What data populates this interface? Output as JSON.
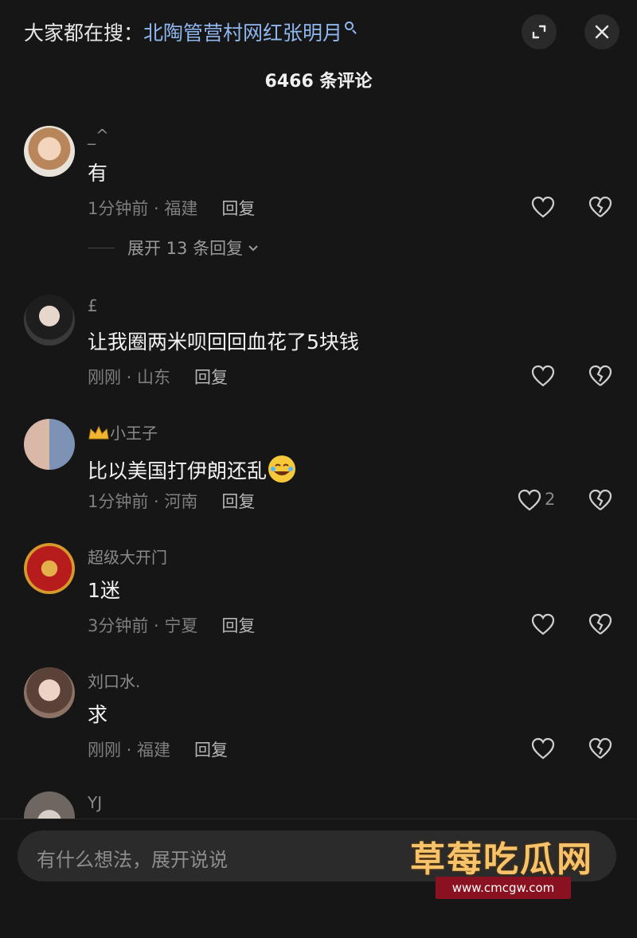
{
  "header": {
    "search_prefix": "大家都在搜：",
    "search_keyword": "北陶管营村网红张明月",
    "comment_count": "6466 条评论"
  },
  "comments": [
    {
      "username": "_^",
      "text": "有",
      "time": "1分钟前",
      "location": "福建",
      "reply_label": "回复",
      "likes": "",
      "expand_label": "展开 13 条回复"
    },
    {
      "username": "£",
      "text": "让我圈两米呗回回血花了5块钱",
      "time": "刚刚",
      "location": "山东",
      "reply_label": "回复",
      "likes": ""
    },
    {
      "username": "小王子",
      "text": "比以美国打伊朗还乱",
      "time": "1分钟前",
      "location": "河南",
      "reply_label": "回复",
      "likes": "2"
    },
    {
      "username": "超级大开门",
      "text": "1迷",
      "time": "3分钟前",
      "location": "宁夏",
      "reply_label": "回复",
      "likes": ""
    },
    {
      "username": "刘口水.",
      "text": "求",
      "time": "刚刚",
      "location": "福建",
      "reply_label": "回复",
      "likes": ""
    },
    {
      "username": "YJ",
      "text": "",
      "time": "",
      "location": "",
      "reply_label": "",
      "likes": ""
    }
  ],
  "input": {
    "placeholder": "有什么想法，展开说说"
  },
  "watermark": {
    "title": "草莓吃瓜网",
    "url": "www.cmcgw.com"
  },
  "colors": {
    "background": "#161616",
    "keyword": "#8fb7ee",
    "watermark": "#f6c36a",
    "watermark_bar": "#8a1220"
  },
  "icons": [
    "search-icon",
    "expand-icon",
    "close-icon",
    "heart-icon",
    "broken-heart-icon",
    "chevron-down-icon",
    "crown-icon",
    "crying-laughing-emoji-icon"
  ]
}
